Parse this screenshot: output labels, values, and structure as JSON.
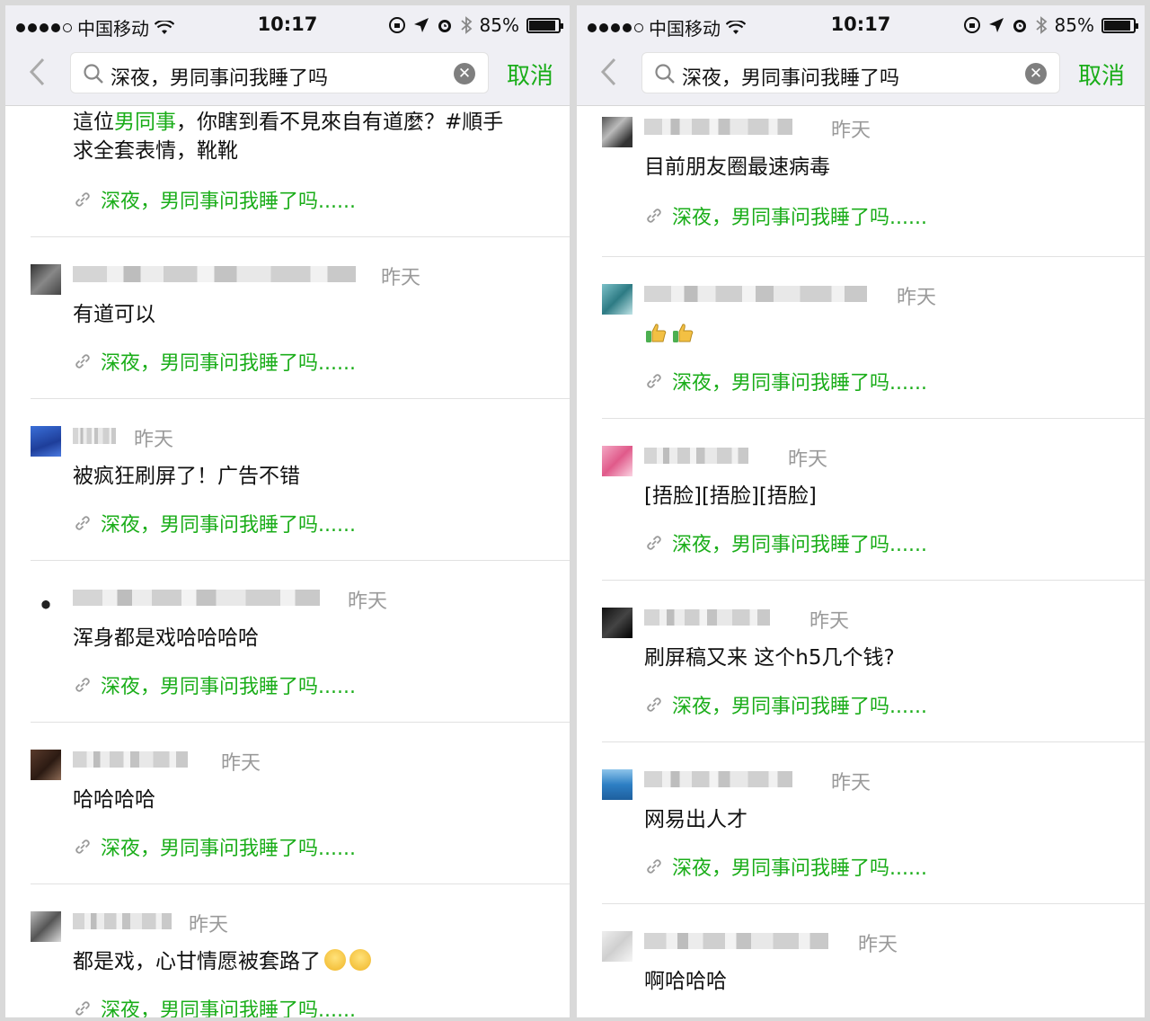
{
  "status": {
    "carrier": "中国移动",
    "time": "10:17",
    "battery": "85%",
    "battery_level": 0.85
  },
  "search": {
    "query": "深夜，男同事问我睡了吗",
    "cancel": "取消"
  },
  "link_text": "深夜，男同事问我睡了吗......",
  "left": {
    "first": {
      "before": "這位",
      "highlight": "男同事",
      "after": "，你瞎到看不見來自有道麼？#順手",
      "line2": "求全套表情，靴靴"
    },
    "items": [
      {
        "time": "昨天",
        "text": "有道可以"
      },
      {
        "time": "昨天",
        "text": "被疯狂刷屏了！广告不错"
      },
      {
        "time": "昨天",
        "text": "浑身都是戏哈哈哈哈"
      },
      {
        "time": "昨天",
        "text": "哈哈哈哈"
      },
      {
        "time": "昨天",
        "text": "都是戏，心甘情愿被套路了"
      }
    ]
  },
  "right": {
    "items": [
      {
        "time": "昨天",
        "text": "目前朋友圈最速病毒"
      },
      {
        "time": "昨天",
        "text": ""
      },
      {
        "time": "昨天",
        "text": "[捂脸][捂脸][捂脸]"
      },
      {
        "time": "昨天",
        "text": "刷屏稿又来 这个h5几个钱?"
      },
      {
        "time": "昨天",
        "text": "网易出人才"
      },
      {
        "time": "昨天",
        "text": "啊哈哈哈"
      }
    ]
  },
  "colors": {
    "accent": "#1aad19",
    "timestamp": "#9a9a9a"
  },
  "icons": [
    "back-arrow-icon",
    "search-icon",
    "clear-icon",
    "link-icon",
    "wifi-icon",
    "location-arrow-icon",
    "alarm-icon",
    "bluetooth-icon",
    "lock-rotation-icon",
    "battery-icon",
    "grin-emoji",
    "thumbs-up-emoji"
  ]
}
